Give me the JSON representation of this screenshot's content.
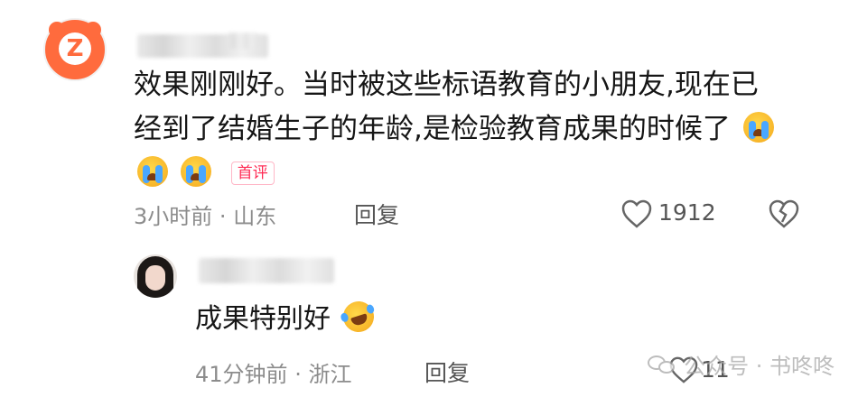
{
  "comment": {
    "author_avatar_icon": "bear-z-icon",
    "author_name": "",
    "text": "效果刚刚好。当时被这些标语教育的小朋友,现在已经到了结婚生子的年龄,是检验教育成果的时候了",
    "emojis": [
      "crying-emoji",
      "crying-emoji",
      "crying-emoji"
    ],
    "badge": "首评",
    "time": "3小时前",
    "separator": "·",
    "location": "山东",
    "reply_label": "回复",
    "like_count": "1912",
    "like_icon": "heart-icon",
    "dislike_icon": "broken-heart-icon"
  },
  "reply": {
    "author_name": "",
    "text": "成果特别好",
    "emoji": "laughing-crying-emoji",
    "time": "41分钟前",
    "separator": "·",
    "location": "浙江",
    "reply_label": "回复",
    "like_count": "11"
  },
  "watermark": {
    "text": "公众号 · 书咚咚",
    "icon": "wechat-icon"
  },
  "colors": {
    "avatar_brand": "#ff6b3d",
    "badge": "#ff2c55",
    "meta": "#8c8c8c"
  }
}
